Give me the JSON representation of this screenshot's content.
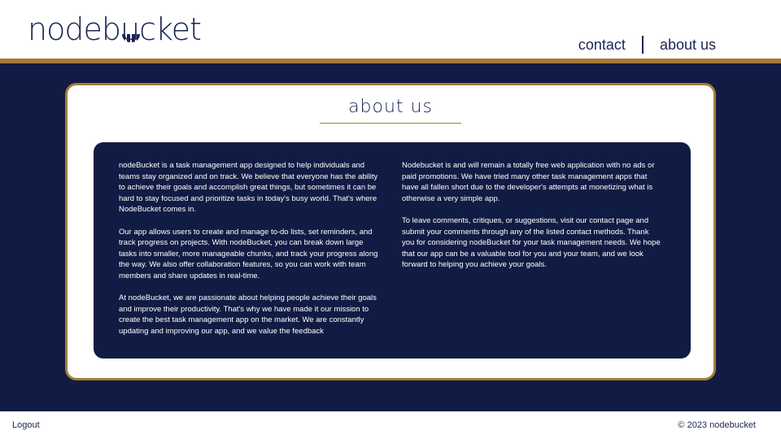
{
  "header": {
    "logo_text_left": "nodeb",
    "logo_text_u": "u",
    "logo_text_right": "cket",
    "nav": [
      {
        "label": "contact"
      },
      {
        "label": "about us"
      }
    ]
  },
  "card": {
    "title": "about us",
    "left_column": [
      "nodeBucket is a task management app designed to help individuals and teams stay organized and on track. We believe that everyone has the ability to achieve their goals and accomplish great things, but sometimes it can be hard to stay focused and prioritize tasks in today's busy world. That's where NodeBucket comes in.",
      "Our app allows users to create and manage to-do lists, set reminders, and track progress on projects. With nodeBucket, you can break down large tasks into smaller, more manageable chunks, and track your progress along the way. We also offer collaboration features, so you can work with team members and share updates in real-time.",
      "At nodeBucket, we are passionate about helping people achieve their goals and improve their productivity. That's why we have made it our mission to create the best task management app on the market. We are constantly updating and improving our app, and we value the feedback"
    ],
    "right_column": [
      "Nodebucket is and will remain a totally free web application with no ads or paid promotions. We have tried many other task management apps that have all fallen short due to the developer's attempts at monetizing what is otherwise a very simple app.",
      "To leave comments, critiques, or suggestions, visit our contact page and submit your comments through any of the listed contact methods. Thank you for considering nodeBucket for your task management needs. We hope that our app can be a valuable tool for you and your team, and we look forward to helping you achieve your goals."
    ]
  },
  "footer": {
    "logout_label": "Logout",
    "copyright": "© 2023 nodebucket"
  },
  "colors": {
    "navy": "#111c44",
    "gold": "#a67c37",
    "text_navy": "#1b2555"
  }
}
